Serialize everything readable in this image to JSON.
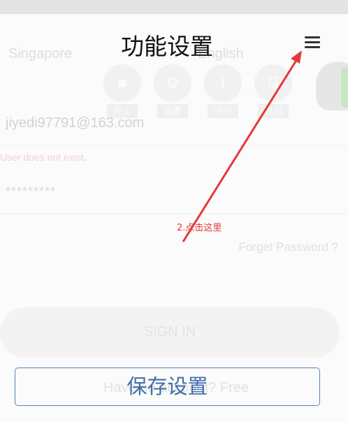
{
  "background": {
    "region": "Singapore",
    "language": "English",
    "email": "jiyedi97791@163.com",
    "error": "User does not exist.",
    "password_masked": "*********",
    "forgot_password": "Forget Password ?",
    "sign_in": "SIGN IN",
    "register": "Have no account? Free",
    "function_buttons": [
      {
        "label": "停止",
        "icon": "stop-icon"
      },
      {
        "label": "设置",
        "icon": "gear-icon"
      },
      {
        "label": "说明",
        "icon": "info-icon"
      },
      {
        "label": "退出",
        "icon": "exit-icon"
      }
    ]
  },
  "dialog": {
    "title": "功能设置",
    "menu_icon": "menu-icon",
    "save_button": "保存设置"
  },
  "annotation": {
    "text": "2.点击这里",
    "color": "#e53935"
  },
  "colors": {
    "accent": "#3f6ea9",
    "annotation": "#e53935"
  }
}
